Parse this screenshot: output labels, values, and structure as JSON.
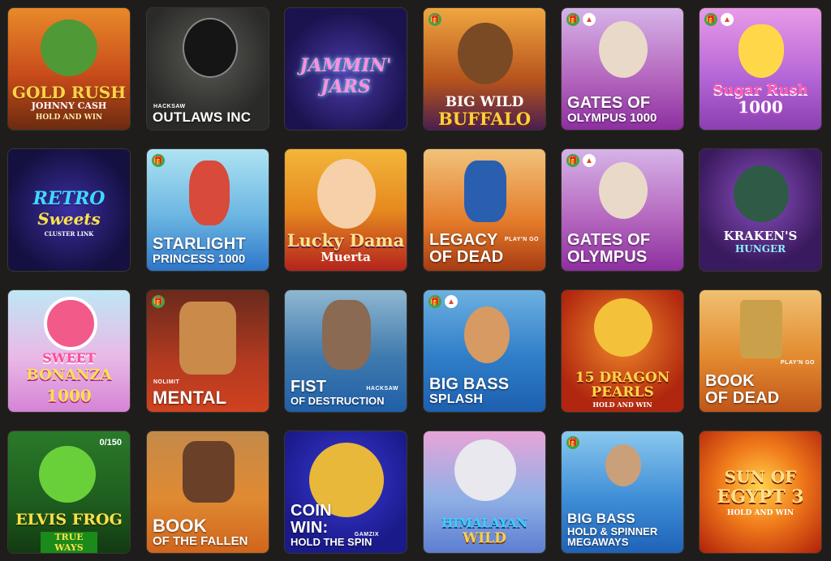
{
  "games": [
    {
      "id": "gold-rush",
      "title": "GOLD RUSH",
      "sub": "JOHNNY CASH",
      "sub2": "HOLD AND WIN"
    },
    {
      "id": "outlaws-inc",
      "title": "OUTLAWS INC",
      "provider": "HACKSAW"
    },
    {
      "id": "jammin-jars",
      "title": "JAMMIN' JARS"
    },
    {
      "id": "big-wild-buffalo",
      "title": "BIG WILD",
      "sub": "BUFFALO"
    },
    {
      "id": "gates-of-olympus-1000",
      "title": "GATES OF",
      "sub": "OLYMPUS 1000"
    },
    {
      "id": "sugar-rush-1000",
      "title": "Sugar Rush",
      "sub": "1000"
    },
    {
      "id": "retro-sweets",
      "title": "RETRO",
      "sub": "Sweets",
      "sub2": "CLUSTER LINK"
    },
    {
      "id": "starlight-princess-1000",
      "title": "STARLIGHT",
      "sub": "PRINCESS 1000"
    },
    {
      "id": "lucky-dama-muerta",
      "title": "Lucky Dama",
      "sub": "Muerta"
    },
    {
      "id": "legacy-of-dead",
      "title": "LEGACY",
      "sub": "OF DEAD",
      "provider": "PLAY'N GO"
    },
    {
      "id": "gates-of-olympus",
      "title": "GATES OF",
      "sub": "OLYMPUS"
    },
    {
      "id": "krakens-hunger",
      "title": "KRAKEN'S",
      "sub": "HUNGER"
    },
    {
      "id": "sweet-bonanza-1000",
      "title": "SWEET",
      "sub": "BONANZA",
      "sub2": "1000"
    },
    {
      "id": "mental",
      "title": "MENTAL",
      "provider": "NOLIMIT"
    },
    {
      "id": "fist-of-destruction",
      "title": "FIST",
      "sub": "OF DESTRUCTION",
      "provider": "HACKSAW"
    },
    {
      "id": "big-bass-splash",
      "title": "BIG BASS",
      "sub": "SPLASH"
    },
    {
      "id": "15-dragon-pearls",
      "title": "15 DRAGON",
      "sub": "PEARLS",
      "sub2": "HOLD AND WIN"
    },
    {
      "id": "book-of-dead",
      "title": "BOOK",
      "sub": "OF DEAD",
      "provider": "PLAY'N GO"
    },
    {
      "id": "elvis-frog",
      "title": "ELVIS FROG",
      "sub": "TRUE WAYS",
      "counter": "0/150"
    },
    {
      "id": "book-of-the-fallen",
      "title": "BOOK",
      "sub": "OF THE FALLEN"
    },
    {
      "id": "coin-win",
      "title": "COIN",
      "sub": "WIN:",
      "sub2": "HOLD THE SPIN",
      "provider": "GAMZIX"
    },
    {
      "id": "himalayan-wild",
      "title": "HIMALAYAN",
      "sub": "WILD"
    },
    {
      "id": "big-bass-hold-spinner",
      "title": "BIG BASS",
      "sub": "HOLD & SPINNER",
      "sub2": "MEGAWAYS"
    },
    {
      "id": "sun-of-egypt-3",
      "title": "SUN OF",
      "sub": "EGYPT 3",
      "sub2": "HOLD AND WIN"
    }
  ],
  "colors": {
    "background": "#1e1d1b",
    "gift": "#3aa64a",
    "hot": "#e0452c"
  }
}
